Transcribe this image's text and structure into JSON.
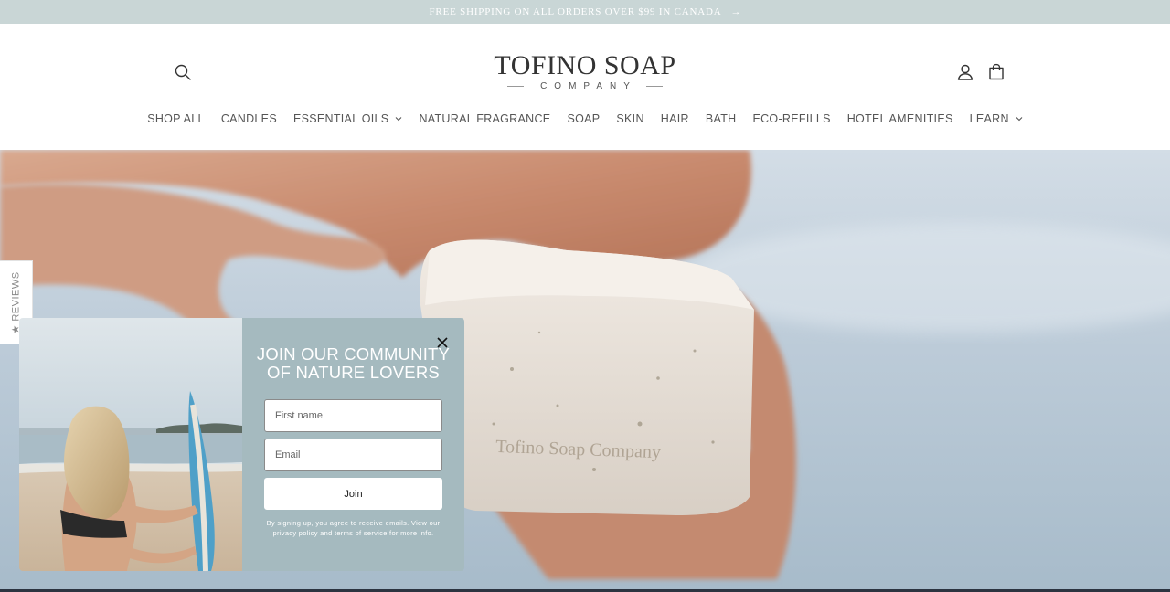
{
  "announcement": {
    "text": "FREE SHIPPING ON ALL ORDERS OVER $99 IN CANADA",
    "arrow": "→"
  },
  "header": {
    "search_icon": "search-icon",
    "logo": {
      "main": "TOFINO SOAP",
      "sub": "COMPANY"
    },
    "account_icon": "account-icon",
    "cart_icon": "cart-icon"
  },
  "nav": {
    "items": [
      {
        "label": "SHOP ALL",
        "dropdown": false
      },
      {
        "label": "CANDLES",
        "dropdown": false
      },
      {
        "label": "ESSENTIAL OILS",
        "dropdown": true
      },
      {
        "label": "NATURAL FRAGRANCE",
        "dropdown": false
      },
      {
        "label": "SOAP",
        "dropdown": false
      },
      {
        "label": "SKIN",
        "dropdown": false
      },
      {
        "label": "HAIR",
        "dropdown": false
      },
      {
        "label": "BATH",
        "dropdown": false
      },
      {
        "label": "ECO-REFILLS",
        "dropdown": false
      },
      {
        "label": "HOTEL AMENITIES",
        "dropdown": false
      },
      {
        "label": "LEARN",
        "dropdown": true
      }
    ]
  },
  "hero": {
    "soap_text": "Tofino Soap Company"
  },
  "reviews_tab": {
    "label": "★ REVIEWS"
  },
  "popup": {
    "title_line1": "JOIN OUR COMMUNITY",
    "title_line2": "OF NATURE LOVERS",
    "first_name_placeholder": "First name",
    "email_placeholder": "Email",
    "join_label": "Join",
    "disclaimer": "By signing up, you agree to receive emails. View our privacy policy and terms of service for more info.",
    "close_icon": "close-icon"
  },
  "colors": {
    "announcement_bg": "#c9d6d6",
    "popup_bg": "#a5babf",
    "hero_water": "#b9c9d6"
  }
}
